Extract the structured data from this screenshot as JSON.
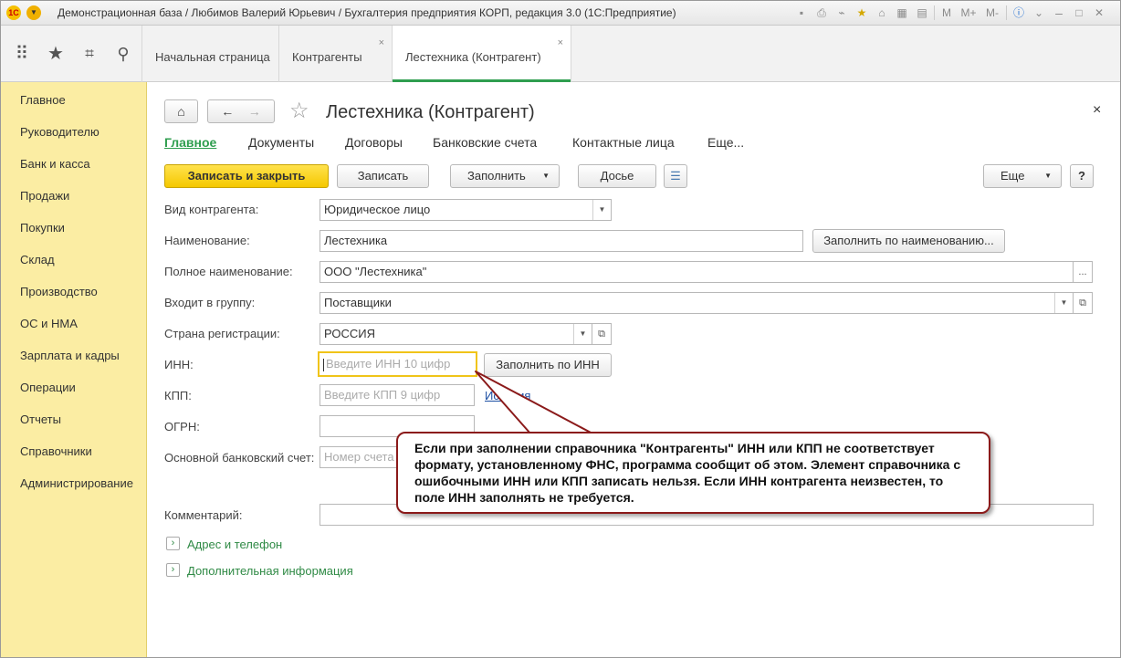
{
  "titlebar": {
    "logo_text": "1С",
    "title": "Демонстрационная база / Любимов Валерий Юрьевич / Бухгалтерия предприятия КОРП, редакция 3.0  (1С:Предприятие)",
    "m_label": "M",
    "mplus_label": "M+",
    "mminus_label": "M-"
  },
  "navbar": {
    "tabs": [
      {
        "label": "Начальная страница"
      },
      {
        "label": "Контрагенты"
      },
      {
        "label": "Лестехника (Контрагент)"
      }
    ]
  },
  "sidebar": {
    "items": [
      {
        "label": "Главное"
      },
      {
        "label": "Руководителю"
      },
      {
        "label": "Банк и касса"
      },
      {
        "label": "Продажи"
      },
      {
        "label": "Покупки"
      },
      {
        "label": "Склад"
      },
      {
        "label": "Производство"
      },
      {
        "label": "ОС и НМА"
      },
      {
        "label": "Зарплата и кадры"
      },
      {
        "label": "Операции"
      },
      {
        "label": "Отчеты"
      },
      {
        "label": "Справочники"
      },
      {
        "label": "Администрирование"
      }
    ]
  },
  "form": {
    "title": "Лестехника (Контрагент)",
    "nav_tabs": [
      {
        "label": "Главное"
      },
      {
        "label": "Документы"
      },
      {
        "label": "Договоры"
      },
      {
        "label": "Банковские счета"
      },
      {
        "label": "Контактные лица"
      },
      {
        "label": "Еще..."
      }
    ],
    "toolbar": {
      "save_close": "Записать и закрыть",
      "save": "Записать",
      "fill": "Заполнить",
      "dossier": "Досье",
      "more": "Еще",
      "help": "?"
    },
    "fields": {
      "kind_label": "Вид контрагента:",
      "kind_value": "Юридическое лицо",
      "name_label": "Наименование:",
      "name_value": "Лестехника",
      "fill_by_name": "Заполнить по наименованию...",
      "fullname_label": "Полное наименование:",
      "fullname_value": "ООО \"Лестехника\"",
      "group_label": "Входит в группу:",
      "group_value": "Поставщики",
      "country_label": "Страна регистрации:",
      "country_value": "РОССИЯ",
      "inn_label": "ИНН:",
      "inn_placeholder": "Введите ИНН 10 цифр",
      "fill_by_inn": "Заполнить по ИНН",
      "kpp_label": "КПП:",
      "kpp_placeholder": "Введите КПП 9 цифр",
      "kpp_history_link": "История",
      "ogrn_label": "ОГРН:",
      "bank_label": "Основной банковский счет:",
      "bank_placeholder": "Номер счета",
      "comment_label": "Комментарий:"
    },
    "sections": {
      "address": "Адрес и телефон",
      "additional": "Дополнительная информация"
    }
  },
  "callout": {
    "text": "Если при заполнении справочника \"Контрагенты\" ИНН или КПП не соответствует формату, установленному ФНС, программа сообщит об этом. Элемент справочника с ошибочными ИНН или КПП записать нельзя. Если ИНН контрагента неизвестен, то поле ИНН заполнять не требуется."
  }
}
